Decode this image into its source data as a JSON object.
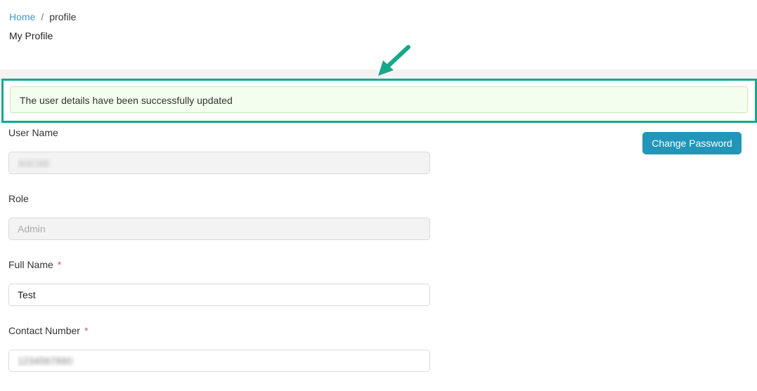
{
  "breadcrumb": {
    "home": "Home",
    "separator": "/",
    "current": "profile"
  },
  "page": {
    "title": "My Profile"
  },
  "alert": {
    "message": "The user details have been successfully updated",
    "highlight_color": "#16a88b"
  },
  "form": {
    "username": {
      "label": "User Name",
      "value": "test.lab"
    },
    "role": {
      "label": "Role",
      "value": "Admin"
    },
    "full_name": {
      "label": "Full Name",
      "required_marker": "*",
      "value": "Test"
    },
    "contact_number": {
      "label": "Contact Number",
      "required_marker": "*",
      "value": "1234567890"
    }
  },
  "actions": {
    "change_password": "Change Password",
    "button_color": "#2196b9"
  }
}
